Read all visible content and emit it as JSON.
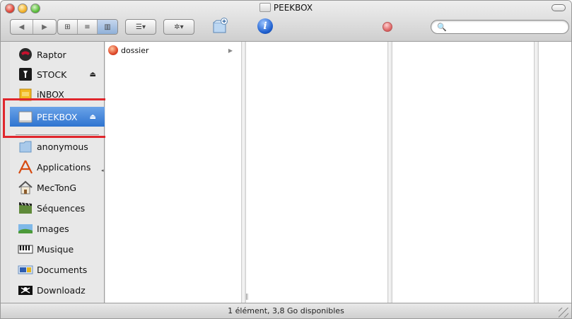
{
  "window": {
    "title": "PEEKBOX"
  },
  "toolbar": {
    "back_label": "◀",
    "forward_label": "▶",
    "view_icons_label": "⊞",
    "view_list_label": "≡",
    "view_columns_label": "▥",
    "arrange_label": "☰▾",
    "action_label": "✲▾",
    "search_glass": "🔍",
    "search_value": ""
  },
  "sidebar": {
    "items": [
      {
        "label": "Raptor",
        "icon": "hard-disk-icon"
      },
      {
        "label": "STOCK",
        "icon": "external-disk-icon",
        "eject": "⏏"
      },
      {
        "label": "iNBOX",
        "icon": "inbox-disk-icon"
      },
      {
        "label": "PEEKBOX",
        "icon": "removable-disk-icon",
        "eject": "⏏",
        "selected": true
      },
      {
        "label": "anonymous",
        "icon": "folder-icon"
      },
      {
        "label": "Applications",
        "icon": "applications-icon"
      },
      {
        "label": "MecTonG",
        "icon": "home-icon"
      },
      {
        "label": "Séquences",
        "icon": "movies-icon"
      },
      {
        "label": "Images",
        "icon": "pictures-icon"
      },
      {
        "label": "Musique",
        "icon": "music-icon"
      },
      {
        "label": "Documents",
        "icon": "documents-icon"
      },
      {
        "label": "Downloadz",
        "icon": "downloads-icon"
      }
    ]
  },
  "columns": {
    "first": {
      "items": [
        {
          "label": "dossier",
          "has_children": true,
          "arrow": "▶"
        }
      ]
    }
  },
  "status": {
    "text": "1 élément, 3,8 Go disponibles"
  },
  "colors": {
    "selection": "#2f74d0",
    "highlight_box": "#e0262c"
  }
}
